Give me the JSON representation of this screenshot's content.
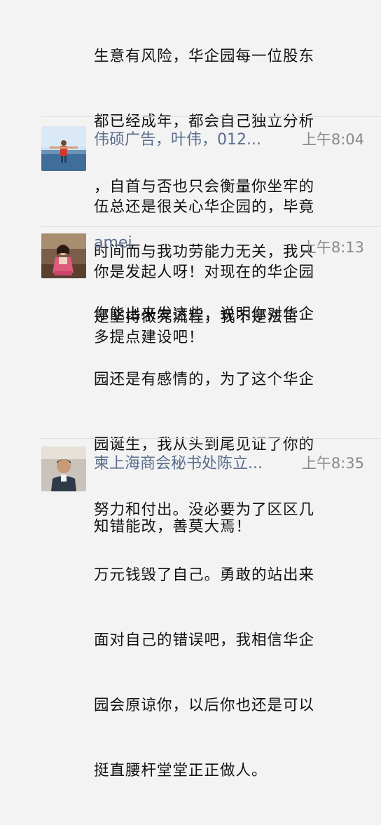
{
  "messages": [
    {
      "name": "",
      "time": "",
      "lines": [
        "生意有风险，华企园每一位股东",
        "都已经成年，都会自己独立分析",
        "，自首与否也只会衡量你坐牢的",
        "时间而与我功劳能力无关，我只",
        "是坚持做完流程，我不是法官"
      ]
    },
    {
      "name": "伟硕广告，叶伟，012...",
      "time": "上午8:04",
      "lines": [
        "伍总还是很关心华企园的，毕竟",
        "你是发起人呀！对现在的华企园",
        "多提点建设吧！"
      ]
    },
    {
      "name": "amei",
      "time": "上午8:13",
      "lines": [
        "你能出来发这些，说明你对华企",
        "园还是有感情的，为了这个华企",
        "园诞生，我从头到尾见证了你的",
        "努力和付出。没必要为了区区几",
        "万元钱毁了自己。勇敢的站出来",
        "面对自己的错误吧，我相信华企",
        "园会原谅你，以后你也还是可以",
        "挺直腰杆堂堂正正做人。"
      ]
    },
    {
      "name": "柬上海商会秘书处陈立...",
      "time": "上午8:35",
      "lines": [
        "知错能改，善莫大焉！"
      ]
    }
  ],
  "colors": {
    "background": "#f3f3f3",
    "name": "#5a6d8c",
    "time": "#888888",
    "text": "#111111"
  }
}
